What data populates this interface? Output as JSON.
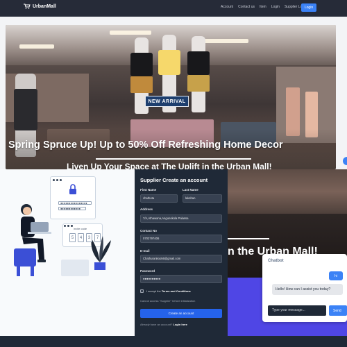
{
  "navbar": {
    "brand": "UrbanMall",
    "links": [
      "Account",
      "Contact us",
      "Item",
      "Login",
      "Supplier Log"
    ],
    "login_label": "Login"
  },
  "hero": {
    "store_banner": "NEW ARRIVAL",
    "title": "Spring Spruce Up! Up to 50% Off Refreshing Home Decor",
    "subtitle": "Liven Up Your Space at The Uplift in the Urban Mall!",
    "subtitle2": "n the Urban Mall!"
  },
  "illustration": {
    "password_mask": "●●●●●●●●●●●●●●●●",
    "password_mask2": "●●●●●●●●●●●●",
    "invite_label": "invite code",
    "code_digits": [
      "5",
      "4",
      "3",
      "7"
    ]
  },
  "form": {
    "title": "Supplier Create an account",
    "first_name_label": "First Name",
    "first_name_value": "chathuta",
    "last_name_label": "Last Name",
    "last_name_value": "lakshan",
    "address_label": "Address",
    "address_value": "7/A,Athawana,Angunokola Palassa",
    "contact_label": "Contact No",
    "contact_value": "0703797406",
    "email_label": "E-mail",
    "email_value": "Chathurankoo56@gmail.com",
    "password_label": "Password",
    "password_value": "●●●●●●●●●●",
    "terms_prefix": "I accept the",
    "terms_link": "Terms and Conditions",
    "warning": "Cannot access \"Supplier\" before initialization",
    "create_button": "Create an account",
    "signin_prefix": "Already have an account?",
    "signin_link": "Login here"
  },
  "chatbot": {
    "title": "Chatbot",
    "user_message": "hi",
    "bot_message": "Hello! How can I assist you today?",
    "input_placeholder": "Type your message...",
    "send_label": "Send"
  }
}
